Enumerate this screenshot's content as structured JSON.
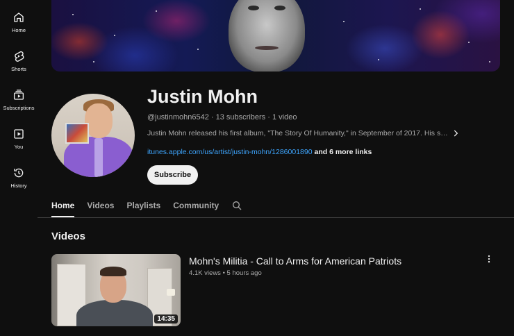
{
  "nav": {
    "items": [
      {
        "label": "Home",
        "icon": "home-icon"
      },
      {
        "label": "Shorts",
        "icon": "shorts-icon"
      },
      {
        "label": "Subscriptions",
        "icon": "subscriptions-icon"
      },
      {
        "label": "You",
        "icon": "you-icon"
      },
      {
        "label": "History",
        "icon": "history-icon"
      }
    ]
  },
  "channel": {
    "name": "Justin Mohn",
    "handle": "@justinmohn6542",
    "subscribers": "13 subscribers",
    "videos_count": "1 video",
    "description": "Justin Mohn released his first album, \"The Story Of Humanity,\" in September of 2017. His s…",
    "link": "itunes.apple.com/us/artist/justin-mohn/1286001890",
    "more_links": "and 6 more links",
    "subscribe_label": "Subscribe"
  },
  "tabs": [
    {
      "label": "Home",
      "active": true
    },
    {
      "label": "Videos",
      "active": false
    },
    {
      "label": "Playlists",
      "active": false
    },
    {
      "label": "Community",
      "active": false
    }
  ],
  "videos_section": {
    "title": "Videos",
    "items": [
      {
        "title": "Mohn's Militia - Call to Arms for American Patriots",
        "views": "4.1K views",
        "age": "5 hours ago",
        "duration": "14:35"
      }
    ]
  },
  "colors": {
    "background": "#0f0f0f",
    "text_primary": "#f1f1f1",
    "text_secondary": "#aaaaaa",
    "link": "#3ea6ff"
  }
}
